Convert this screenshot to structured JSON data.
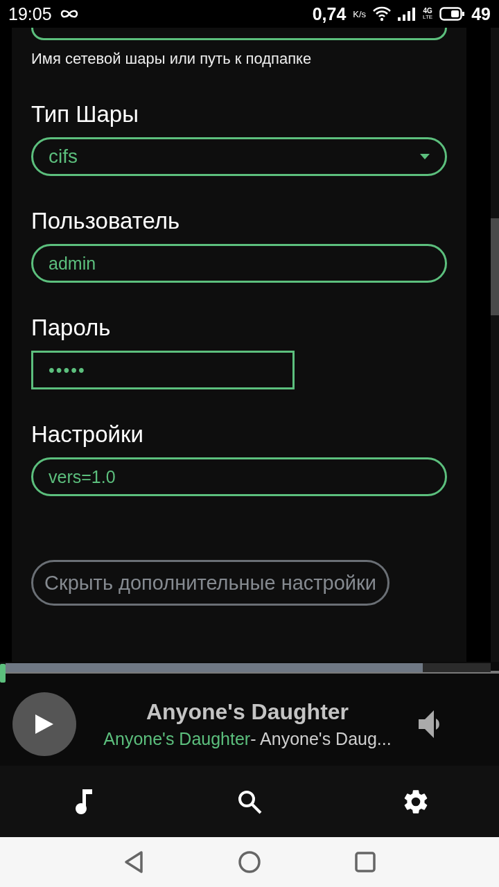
{
  "status_bar": {
    "time": "19:05",
    "speed": "0,74",
    "speed_unit": "K/s",
    "network": "4G",
    "network_sub": "LTE",
    "battery": "49"
  },
  "form": {
    "share_hint": "Имя сетевой шары или путь к подпапке",
    "fields": [
      {
        "kind": "select",
        "label": "Тип Шары",
        "value": "cifs"
      },
      {
        "kind": "text",
        "label": "Пользователь",
        "value": "admin"
      },
      {
        "kind": "password",
        "label": "Пароль",
        "value": "•••••"
      },
      {
        "kind": "text",
        "label": "Настройки",
        "value": "vers=1.0"
      }
    ],
    "toggle_button": "Скрыть дополнительные настройки"
  },
  "player": {
    "level": 0,
    "buffer": {
      "level": 0.86
    },
    "title": "Anyone's Daughter",
    "artist": "Anyone's Daughter",
    "track": "- Anyone's Daug..."
  },
  "nav": [
    {
      "kind": "music"
    },
    {
      "kind": "search"
    },
    {
      "kind": "settings"
    }
  ]
}
